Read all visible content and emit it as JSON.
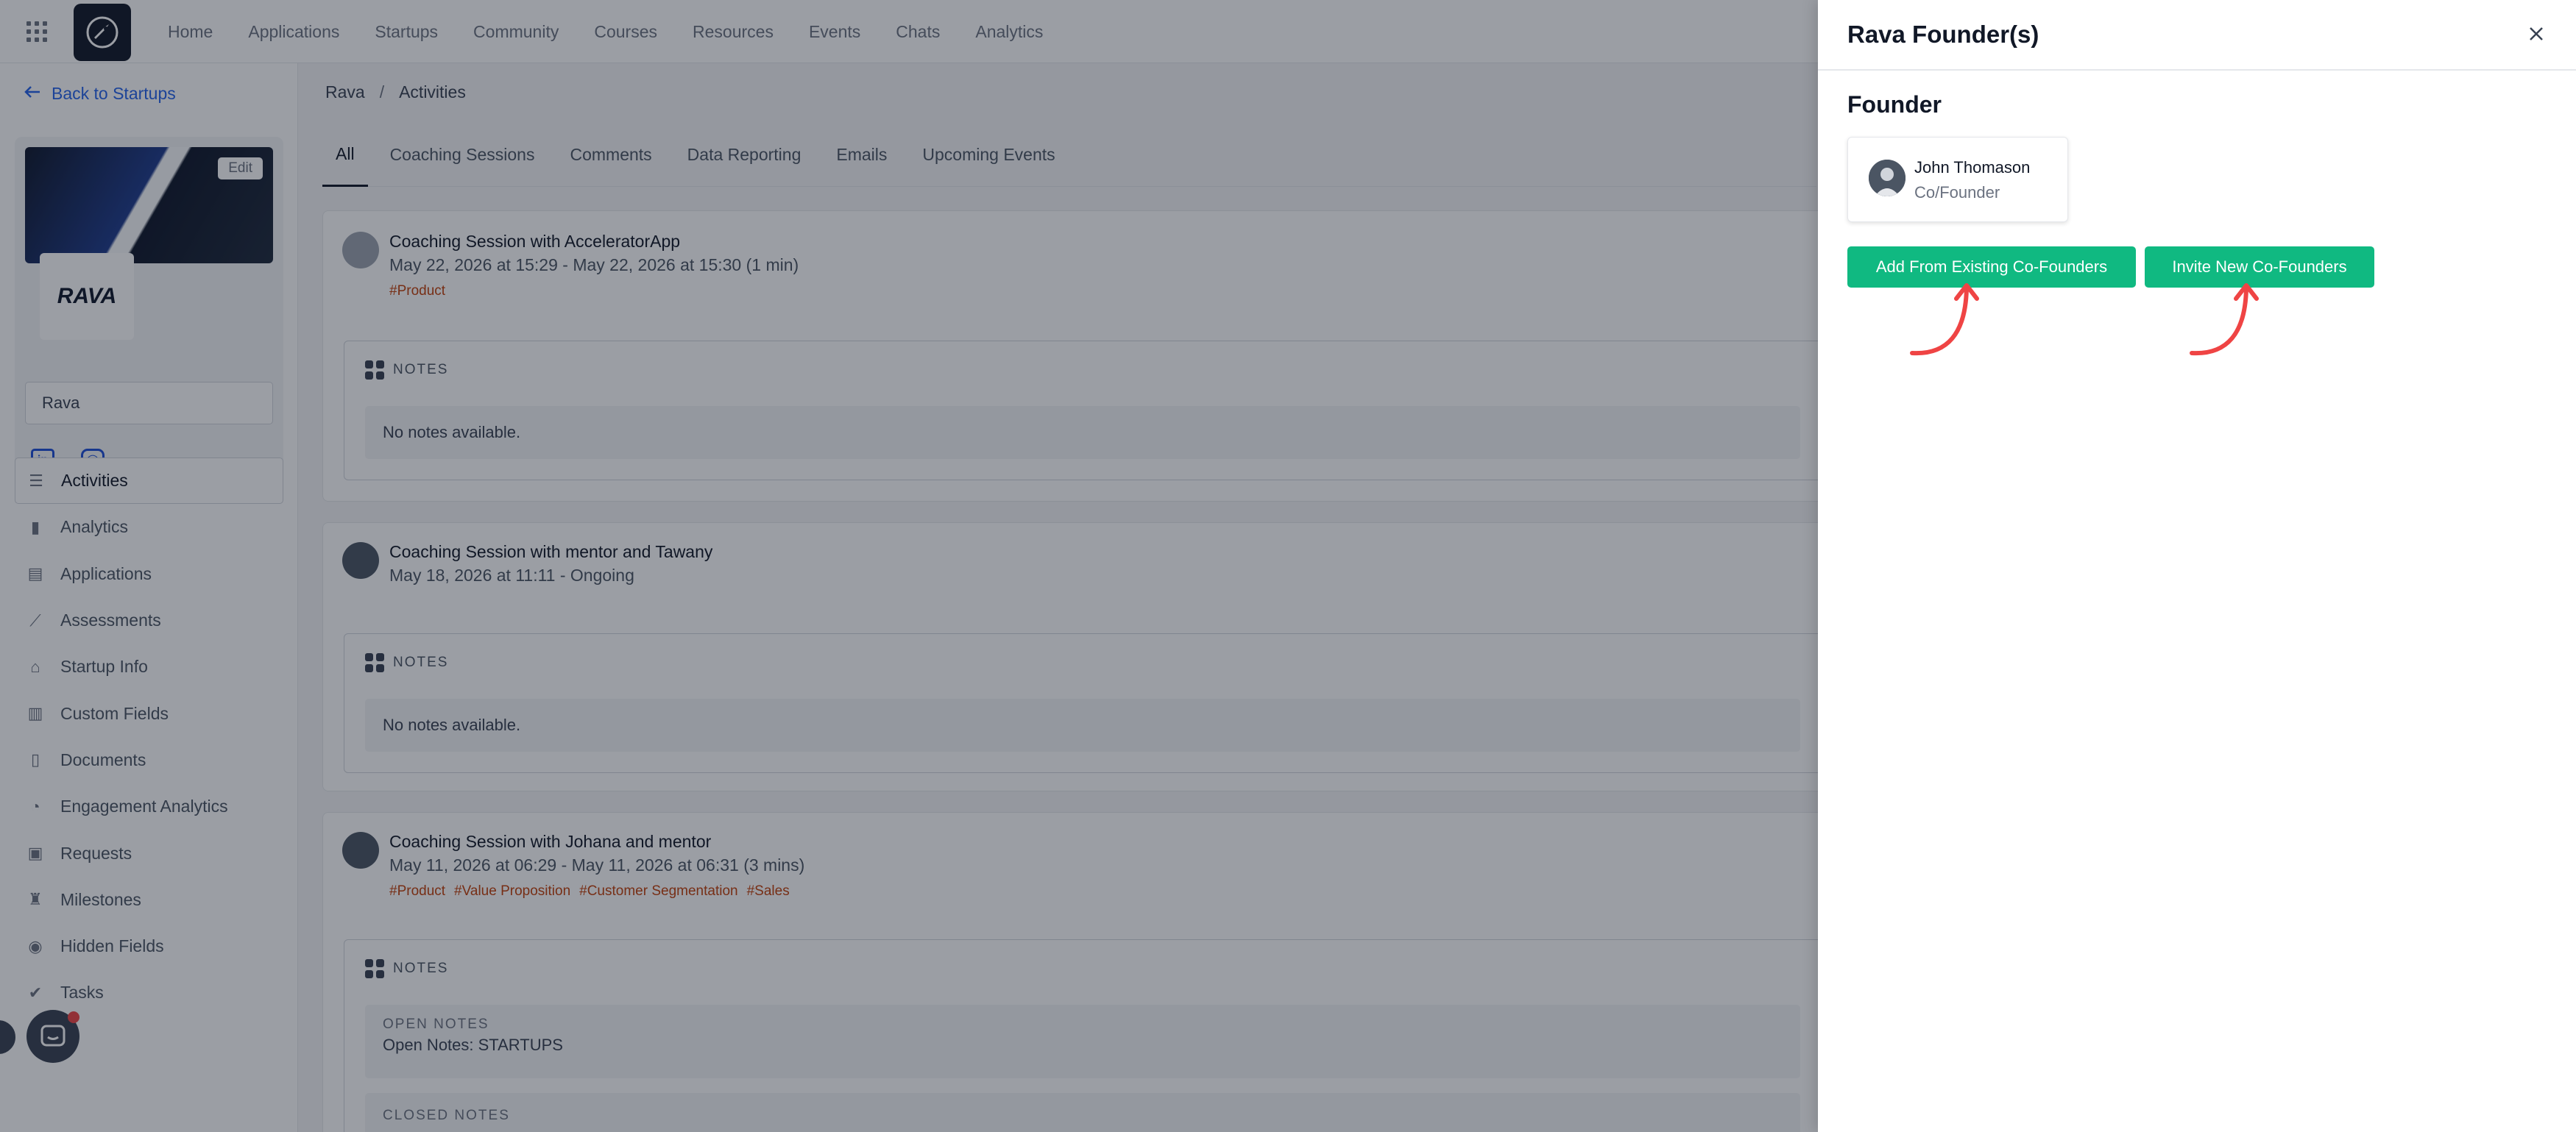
{
  "topnav": {
    "items": [
      "Home",
      "Applications",
      "Startups",
      "Community",
      "Courses",
      "Resources",
      "Events",
      "Chats",
      "Analytics"
    ]
  },
  "sidebar": {
    "back_label": "Back to Startups",
    "edit_label": "Edit",
    "logo_text": "RAVA",
    "startup_name": "Rava",
    "menu": [
      {
        "label": "Activities",
        "icon": "list-icon",
        "active": true
      },
      {
        "label": "Analytics",
        "icon": "bar-chart-icon"
      },
      {
        "label": "Applications",
        "icon": "id-card-icon"
      },
      {
        "label": "Assessments",
        "icon": "line-chart-icon"
      },
      {
        "label": "Startup Info",
        "icon": "bank-icon"
      },
      {
        "label": "Custom Fields",
        "icon": "columns-icon"
      },
      {
        "label": "Documents",
        "icon": "document-icon"
      },
      {
        "label": "Engagement Analytics",
        "icon": "pie-chart-icon"
      },
      {
        "label": "Requests",
        "icon": "clipboard-icon"
      },
      {
        "label": "Milestones",
        "icon": "trophy-icon"
      },
      {
        "label": "Hidden Fields",
        "icon": "eye-off-icon"
      },
      {
        "label": "Tasks",
        "icon": "check-circle-icon"
      }
    ]
  },
  "breadcrumb": {
    "root": "Rava",
    "separator": "/",
    "current": "Activities"
  },
  "tabs": [
    "All",
    "Coaching Sessions",
    "Comments",
    "Data Reporting",
    "Emails",
    "Upcoming Events"
  ],
  "activities": [
    {
      "title": "Coaching Session with AcceleratorApp",
      "subtitle": "May 22, 2026 at 15:29 - May 22, 2026 at 15:30 (1 min)",
      "tags": [
        "#Product"
      ],
      "notes_label": "NOTES",
      "notes_text": "No notes available."
    },
    {
      "title": "Coaching Session with mentor and Tawany",
      "subtitle": "May 18, 2026 at 11:11 - Ongoing",
      "tags": [],
      "notes_label": "NOTES",
      "notes_text": "No notes available."
    },
    {
      "title": "Coaching Session with Johana and mentor",
      "subtitle": "May 11, 2026 at 06:29 - May 11, 2026 at 06:31 (3 mins)",
      "tags": [
        "#Product",
        "#Value Proposition",
        "#Customer Segmentation",
        "#Sales"
      ],
      "notes_label": "NOTES",
      "open_notes_label": "OPEN NOTES",
      "open_notes_text": "Open Notes: STARTUPS",
      "closed_notes_label": "CLOSED NOTES"
    }
  ],
  "drawer": {
    "title": "Rava Founder(s)",
    "section_title": "Founder",
    "founder": {
      "name": "John Thomason",
      "role": "Co/Founder"
    },
    "add_existing_label": "Add From Existing Co-Founders",
    "invite_new_label": "Invite New Co-Founders",
    "accent_color": "#10b981",
    "arrow_color": "#ef4444"
  }
}
